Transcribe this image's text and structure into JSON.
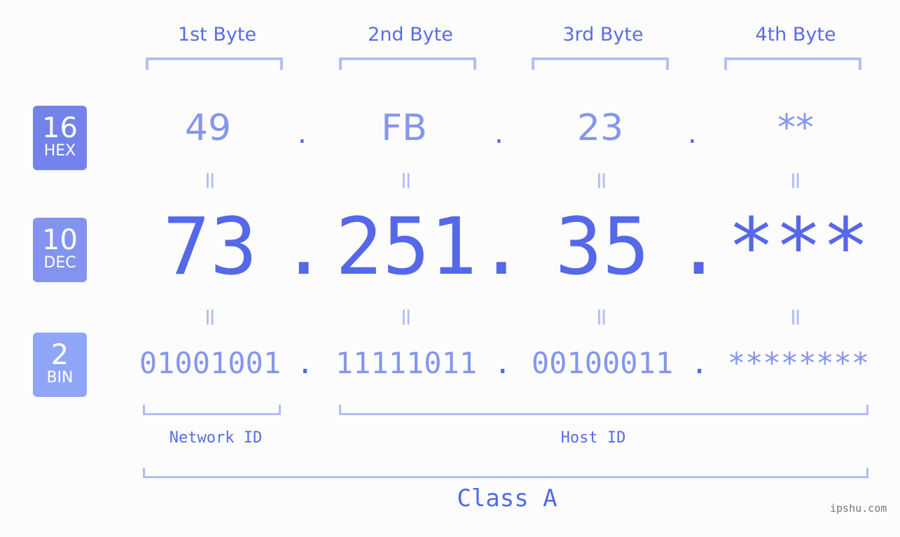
{
  "byte_headers": [
    "1st Byte",
    "2nd Byte",
    "3rd Byte",
    "4th Byte"
  ],
  "badges": [
    {
      "number": "16",
      "label": "HEX",
      "color": "#7383ea"
    },
    {
      "number": "10",
      "label": "DEC",
      "color": "#8393ef"
    },
    {
      "number": "2",
      "label": "BIN",
      "color": "#8fa6f7"
    }
  ],
  "hex": [
    "49",
    "FB",
    "23",
    "**"
  ],
  "dec": [
    "73",
    "251",
    "35",
    "***"
  ],
  "bin": [
    "01001001",
    "11111011",
    "00100011",
    "********"
  ],
  "separator": ".",
  "equals": "=",
  "network_id_label": "Network ID",
  "host_id_label": "Host ID",
  "class_label": "Class A",
  "watermark": "ipshu.com",
  "colors": {
    "primary": "#5568e8",
    "light": "#8696ec",
    "bracket": "#b3bdf7"
  }
}
